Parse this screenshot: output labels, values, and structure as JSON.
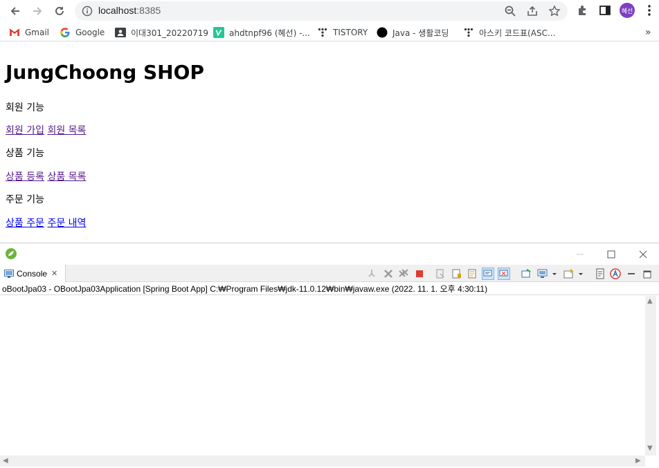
{
  "browser": {
    "url_host": "localhost",
    "url_port": ":8385",
    "profile_initials": "혜선",
    "bookmarks": [
      {
        "label": "Gmail",
        "icon": "gmail-icon"
      },
      {
        "label": "Google",
        "icon": "google-icon"
      },
      {
        "label": "이대301_20220719",
        "icon": "contact-card-icon"
      },
      {
        "label": "ahdtnpf96 (혜선) -...",
        "icon": "velog-icon"
      },
      {
        "label": "TISTORY",
        "icon": "tistory-icon"
      },
      {
        "label": "Java - 생활코딩",
        "icon": "circle-icon"
      },
      {
        "label": "아스키 코드표(ASC...",
        "icon": "tistory-icon"
      }
    ],
    "overflow_label": "»"
  },
  "page": {
    "title": "JungChoong SHOP",
    "sections": [
      {
        "heading": "회원 기능",
        "links": [
          "회원 가입",
          "회원 목록"
        ]
      },
      {
        "heading": "상품 기능",
        "links": [
          "상품 등록",
          "상품 목록"
        ]
      },
      {
        "heading": "주문 기능",
        "links": [
          "상품 주문",
          "주문 내역"
        ]
      }
    ]
  },
  "eclipse": {
    "tab_label": "Console",
    "status": "oBootJpa03 - OBootJpa03Application [Spring Boot App] C:₩Program Files₩jdk-11.0.12₩bin₩javaw.exe  (2022. 11. 1. 오후 4:30:11)"
  },
  "colors": {
    "link": "#0000ee",
    "visited_link": "#551a8b",
    "profile_bg": "#7b3fbf",
    "velog_green": "#20c997"
  }
}
